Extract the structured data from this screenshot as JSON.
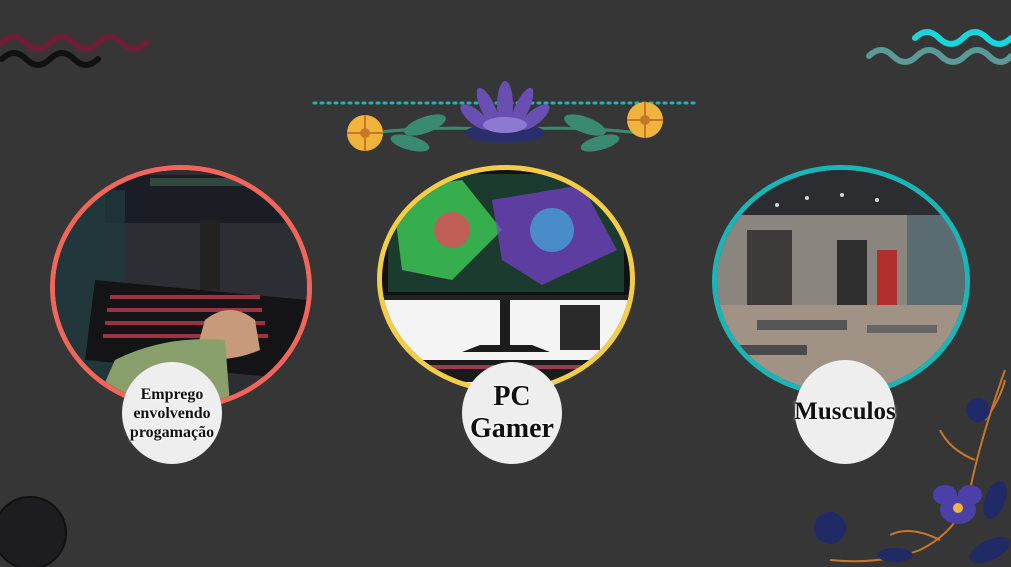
{
  "colors": {
    "background": "#363636",
    "ring_left": "#f2665a",
    "ring_middle": "#f3cd45",
    "ring_right": "#19b6b8",
    "wave_maroon": "#6d1f33",
    "wave_black": "#111111",
    "wave_cyan": "#18d6db",
    "wave_teal": "#5a9a97",
    "dotted_line": "#19b6b8",
    "flower_purple": "#6a4fb3",
    "flower_yellow": "#f0b33c",
    "leaf_green": "#3a8a72",
    "flower_navy": "#1f2a66",
    "flower_violet": "#4b3fa8",
    "stem_orange": "#c7772c"
  },
  "cards": [
    {
      "id": "emprego",
      "lines": [
        "Emprego",
        "envolvendo",
        "progamação"
      ],
      "image": "keyboard-typing-photo"
    },
    {
      "id": "pc",
      "lines": [
        "PC",
        "Gamer"
      ],
      "image": "gaming-monitor-photo"
    },
    {
      "id": "musculos",
      "lines": [
        "Musculos"
      ],
      "image": "gym-interior-photo"
    }
  ]
}
